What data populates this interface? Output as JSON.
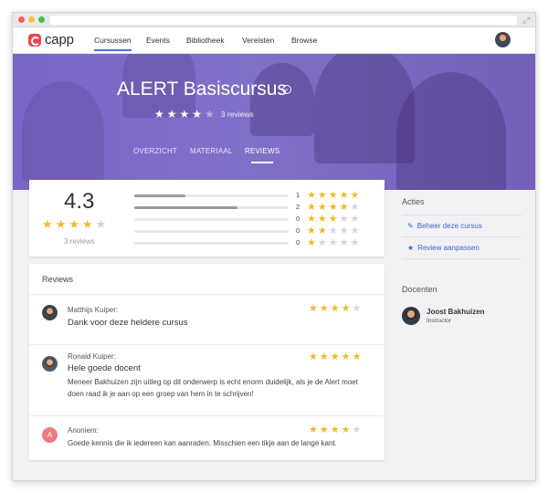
{
  "nav": {
    "logo_text": "capp",
    "items": [
      "Cursussen",
      "Events",
      "Bibliotheek",
      "Vereisten",
      "Browse"
    ],
    "active_index": 0
  },
  "course": {
    "title": "ALERT Basiscursus",
    "stars_filled": 4,
    "stars_total": 5,
    "reviews_text": "3 reviews",
    "tabs": [
      "OVERZICHT",
      "MATERIAAL",
      "REVIEWS"
    ],
    "active_tab": 2
  },
  "rating": {
    "score": "4.3",
    "stars_filled": 4,
    "count_text": "3 reviews",
    "histogram": [
      {
        "stars": 5,
        "count": "1",
        "fill": 0.33
      },
      {
        "stars": 4,
        "count": "2",
        "fill": 0.67
      },
      {
        "stars": 3,
        "count": "0",
        "fill": 0
      },
      {
        "stars": 2,
        "count": "0",
        "fill": 0
      },
      {
        "stars": 1,
        "count": "0",
        "fill": 0
      }
    ]
  },
  "reviews": {
    "title": "Reviews",
    "items": [
      {
        "name": "Matthijs Kuiper:",
        "headline": "Dank voor deze heldere cursus",
        "body": "",
        "stars": 4,
        "avatar": "photo1",
        "initial": ""
      },
      {
        "name": "Ronald Kuiper:",
        "headline": "Hele goede docent",
        "body": "Meneer Bakhuizen zijn uitleg op dit onderwerp is echt enorm duidelijk, als je de Alert moet doen raad ik je aan op een groep van hem in te schrijven!",
        "stars": 5,
        "avatar": "photo2",
        "initial": ""
      },
      {
        "name": "Anoniem:",
        "headline": "",
        "body": "Goede kennis die ik iedereen kan aanraden. Misschien een tikje aan de lange kant.",
        "stars": 4,
        "avatar": "letter",
        "initial": "A"
      }
    ]
  },
  "sidebar": {
    "actions_title": "Acties",
    "actions": [
      {
        "label": "Beheer deze cursus",
        "icon": "pencil-icon"
      },
      {
        "label": "Review aanpassen",
        "icon": "star-icon"
      }
    ],
    "teachers_title": "Docenten",
    "teacher": {
      "name": "Joost Bakhuizen",
      "role": "Instructor"
    }
  },
  "colors": {
    "accent": "#4a6ee0",
    "hero": "#7a66c8",
    "star": "#f4b826",
    "link": "#3b66c9"
  }
}
